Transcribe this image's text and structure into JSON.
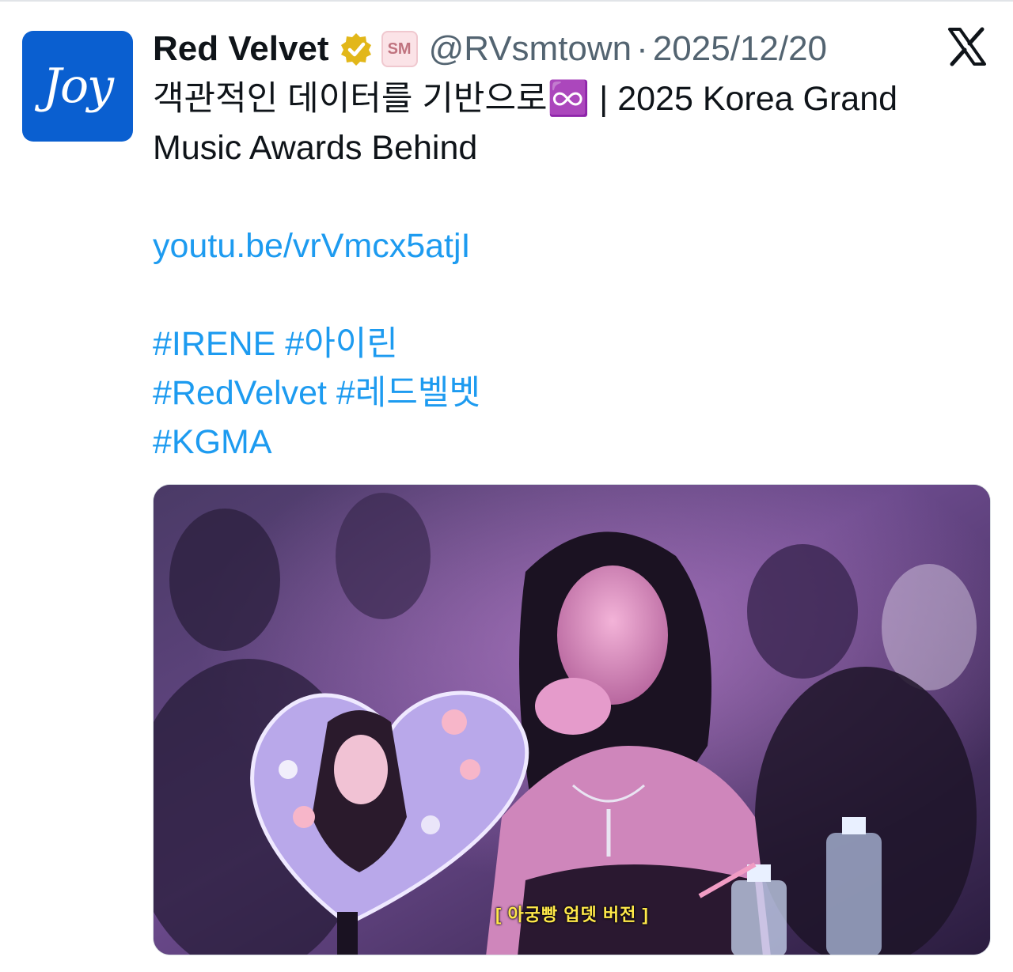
{
  "tweet": {
    "display_name": "Red Velvet",
    "handle": "@RVsmtown",
    "separator": "·",
    "date": "2025/12/20",
    "avatar_text": "Joy",
    "affiliate_badge_text": "SM",
    "text_line1": "객관적인 데이터를 기반으로♾️ | 2025 Korea Grand",
    "text_line2": "Music Awards Behind",
    "link": "youtu.be/vrVmcx5atjI",
    "hashtags_line1": "#IRENE #아이린",
    "hashtags_line2": "#RedVelvet #레드벨벳",
    "hashtags_line3": "#KGMA"
  },
  "media": {
    "caption": "[ 아궁빵 업뎃 버전 ]"
  },
  "icons": {
    "verified": "verified-badge-icon",
    "platform": "x-logo-icon"
  },
  "colors": {
    "link": "#1d9bf0",
    "verified_gold": "#e2b719",
    "secondary_text": "#536471",
    "avatar_bg": "#0a5fd0"
  }
}
